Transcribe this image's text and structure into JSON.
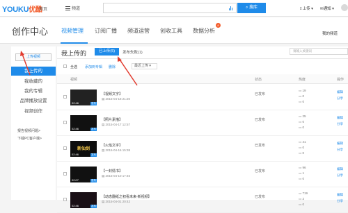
{
  "topbar": {
    "logo": "YOUKU",
    "logo_cn": "优酷",
    "home": "首页",
    "menu": "频道",
    "search_button": "搜库",
    "upload": "上传",
    "notice": "通知"
  },
  "subnav": {
    "title": "创作中心",
    "tabs": [
      "视频管理",
      "订阅广播",
      "频道运营",
      "创收工具",
      "数据分析"
    ],
    "badge": "8",
    "right_link": "我的频道"
  },
  "sidebar": {
    "upload_button": "上传视频",
    "items": [
      "我上传的",
      "我收藏的",
      "我的专辑",
      "品牌播放设置",
      "视频创作"
    ],
    "links": [
      "报告视频问题>",
      "下载PC客户端>"
    ]
  },
  "main": {
    "title": "我上传的",
    "published_tab": "已上传(5)",
    "failed_tab": "发布失败(1)",
    "search_placeholder": "请输入关键词",
    "select_all": "全选",
    "add_to_album": "添加到专辑",
    "delete": "删除",
    "sort": "最近上传",
    "headers": {
      "video": "视频",
      "state": "状态",
      "hot": "热度",
      "op": "操作"
    },
    "rows": [
      {
        "title": "【视频文字】",
        "date": "2015-04-18 21:20",
        "state": "已发布",
        "stats": [
          "19",
          "0",
          "0"
        ],
        "op": [
          "编辑",
          "分享"
        ],
        "duration": "02:46",
        "tag": "发布",
        "thumb_color": "#222",
        "thumb_text": ""
      },
      {
        "title": "【照片素描】",
        "date": "2015-04-17 12:57",
        "state": "已发布",
        "stats": [
          "25",
          "0",
          "0"
        ],
        "op": [
          "编辑",
          "分享"
        ],
        "duration": "02:46",
        "tag": "发布",
        "thumb_color": "#111",
        "thumb_text": ""
      },
      {
        "title": "【火焰文字】",
        "date": "2015-04-16 15:38",
        "state": "已发布",
        "stats": [
          "41",
          "0",
          "0"
        ],
        "op": [
          "编辑",
          "分享"
        ],
        "duration": "02:46",
        "tag": "发布",
        "thumb_color": "#0d0d0d",
        "thumb_text": "新仙剑"
      },
      {
        "title": "【一封情书】",
        "date": "2015-04-10 17:46",
        "state": "已发布",
        "stats": [
          "96",
          "1",
          "0"
        ],
        "op": [
          "编辑",
          "分享"
        ],
        "duration": "02:07",
        "tag": "发布",
        "thumb_color": "#111",
        "thumb_text": ""
      },
      {
        "title": "【动态翻纸之初看未来-新视频】",
        "date": "2015-04-01 20:42",
        "state": "已发布",
        "stats": [
          "719",
          "2",
          "0"
        ],
        "op": [
          "编辑",
          "分享"
        ],
        "duration": "02:46",
        "tag": "发布",
        "thumb_color": "#1a1016",
        "thumb_text": ""
      }
    ]
  }
}
